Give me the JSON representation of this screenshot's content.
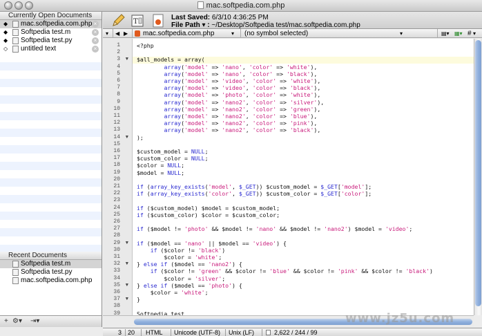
{
  "window": {
    "title": "mac.softpedia.com.php"
  },
  "sidebar": {
    "open_header": "Currently Open Documents",
    "open_docs": [
      {
        "name": "mac.softpedia.com.php",
        "icon": "php-file-icon",
        "selected": true
      },
      {
        "name": "Softpedia test.m",
        "icon": "m-file-icon",
        "selected": false
      },
      {
        "name": "Softpedia test.py",
        "icon": "py-file-icon",
        "selected": false
      },
      {
        "name": "untitled text",
        "icon": "text-file-icon",
        "selected": false
      }
    ],
    "recent_header": "Recent Documents",
    "recent_docs": [
      {
        "name": "Softpedia test.m",
        "selected": true
      },
      {
        "name": "Softpedia test.py",
        "selected": false
      },
      {
        "name": "mac.softpedia.com.php",
        "selected": false
      }
    ]
  },
  "toolbar": {
    "saved_label": "Last Saved:",
    "saved_value": "6/3/10 4:36:25 PM",
    "path_label": "File Path ▾ :",
    "path_value": "~/Desktop/Softpedia test/mac.softpedia.com.php"
  },
  "navbar": {
    "back": "◀",
    "forward": "▶",
    "file_name": "mac.softpedia.com.php",
    "symbol": "(no symbol selected)",
    "hash": "#"
  },
  "code": {
    "lines": [
      [
        [
          "v",
          "<?php"
        ]
      ],
      [
        [
          "v",
          ""
        ]
      ],
      [
        [
          "v",
          "$all_models = array("
        ]
      ],
      [
        [
          "v",
          "        "
        ],
        [
          "k",
          "array"
        ],
        [
          "v",
          "("
        ],
        [
          "s",
          "'model'"
        ],
        [
          "v",
          " => "
        ],
        [
          "s",
          "'nano'"
        ],
        [
          "v",
          ", "
        ],
        [
          "s",
          "'color'"
        ],
        [
          "v",
          " => "
        ],
        [
          "s",
          "'white'"
        ],
        [
          "v",
          "),"
        ]
      ],
      [
        [
          "v",
          "        "
        ],
        [
          "k",
          "array"
        ],
        [
          "v",
          "("
        ],
        [
          "s",
          "'model'"
        ],
        [
          "v",
          " => "
        ],
        [
          "s",
          "'nano'"
        ],
        [
          "v",
          ", "
        ],
        [
          "s",
          "'color'"
        ],
        [
          "v",
          " => "
        ],
        [
          "s",
          "'black'"
        ],
        [
          "v",
          "),"
        ]
      ],
      [
        [
          "v",
          "        "
        ],
        [
          "k",
          "array"
        ],
        [
          "v",
          "("
        ],
        [
          "s",
          "'model'"
        ],
        [
          "v",
          " => "
        ],
        [
          "s",
          "'video'"
        ],
        [
          "v",
          ", "
        ],
        [
          "s",
          "'color'"
        ],
        [
          "v",
          " => "
        ],
        [
          "s",
          "'white'"
        ],
        [
          "v",
          "),"
        ]
      ],
      [
        [
          "v",
          "        "
        ],
        [
          "k",
          "array"
        ],
        [
          "v",
          "("
        ],
        [
          "s",
          "'model'"
        ],
        [
          "v",
          " => "
        ],
        [
          "s",
          "'video'"
        ],
        [
          "v",
          ", "
        ],
        [
          "s",
          "'color'"
        ],
        [
          "v",
          " => "
        ],
        [
          "s",
          "'black'"
        ],
        [
          "v",
          "),"
        ]
      ],
      [
        [
          "v",
          "        "
        ],
        [
          "k",
          "array"
        ],
        [
          "v",
          "("
        ],
        [
          "s",
          "'model'"
        ],
        [
          "v",
          " => "
        ],
        [
          "s",
          "'photo'"
        ],
        [
          "v",
          ", "
        ],
        [
          "s",
          "'color'"
        ],
        [
          "v",
          " => "
        ],
        [
          "s",
          "'white'"
        ],
        [
          "v",
          "),"
        ]
      ],
      [
        [
          "v",
          "        "
        ],
        [
          "k",
          "array"
        ],
        [
          "v",
          "("
        ],
        [
          "s",
          "'model'"
        ],
        [
          "v",
          " => "
        ],
        [
          "s",
          "'nano2'"
        ],
        [
          "v",
          ", "
        ],
        [
          "s",
          "'color'"
        ],
        [
          "v",
          " => "
        ],
        [
          "s",
          "'silver'"
        ],
        [
          "v",
          "),"
        ]
      ],
      [
        [
          "v",
          "        "
        ],
        [
          "k",
          "array"
        ],
        [
          "v",
          "("
        ],
        [
          "s",
          "'model'"
        ],
        [
          "v",
          " => "
        ],
        [
          "s",
          "'nano2'"
        ],
        [
          "v",
          ", "
        ],
        [
          "s",
          "'color'"
        ],
        [
          "v",
          " => "
        ],
        [
          "s",
          "'green'"
        ],
        [
          "v",
          "),"
        ]
      ],
      [
        [
          "v",
          "        "
        ],
        [
          "k",
          "array"
        ],
        [
          "v",
          "("
        ],
        [
          "s",
          "'model'"
        ],
        [
          "v",
          " => "
        ],
        [
          "s",
          "'nano2'"
        ],
        [
          "v",
          ", "
        ],
        [
          "s",
          "'color'"
        ],
        [
          "v",
          " => "
        ],
        [
          "s",
          "'blue'"
        ],
        [
          "v",
          "),"
        ]
      ],
      [
        [
          "v",
          "        "
        ],
        [
          "k",
          "array"
        ],
        [
          "v",
          "("
        ],
        [
          "s",
          "'model'"
        ],
        [
          "v",
          " => "
        ],
        [
          "s",
          "'nano2'"
        ],
        [
          "v",
          ", "
        ],
        [
          "s",
          "'color'"
        ],
        [
          "v",
          " => "
        ],
        [
          "s",
          "'pink'"
        ],
        [
          "v",
          "),"
        ]
      ],
      [
        [
          "v",
          "        "
        ],
        [
          "k",
          "array"
        ],
        [
          "v",
          "("
        ],
        [
          "s",
          "'model'"
        ],
        [
          "v",
          " => "
        ],
        [
          "s",
          "'nano2'"
        ],
        [
          "v",
          ", "
        ],
        [
          "s",
          "'color'"
        ],
        [
          "v",
          " => "
        ],
        [
          "s",
          "'black'"
        ],
        [
          "v",
          "),"
        ]
      ],
      [
        [
          "v",
          ");"
        ]
      ],
      [
        [
          "v",
          ""
        ]
      ],
      [
        [
          "v",
          "$custom_model = "
        ],
        [
          "k",
          "NULL"
        ],
        [
          "v",
          ";"
        ]
      ],
      [
        [
          "v",
          "$custom_color = "
        ],
        [
          "k",
          "NULL"
        ],
        [
          "v",
          ";"
        ]
      ],
      [
        [
          "v",
          "$color = "
        ],
        [
          "k",
          "NULL"
        ],
        [
          "v",
          ";"
        ]
      ],
      [
        [
          "v",
          "$model = "
        ],
        [
          "k",
          "NULL"
        ],
        [
          "v",
          ";"
        ]
      ],
      [
        [
          "v",
          ""
        ]
      ],
      [
        [
          "k",
          "if"
        ],
        [
          "v",
          " ("
        ],
        [
          "k",
          "array_key_exists"
        ],
        [
          "v",
          "("
        ],
        [
          "s",
          "'model'"
        ],
        [
          "v",
          ", "
        ],
        [
          "k",
          "$_GET"
        ],
        [
          "v",
          ")) $custom_model = "
        ],
        [
          "k",
          "$_GET"
        ],
        [
          "v",
          "["
        ],
        [
          "s",
          "'model'"
        ],
        [
          "v",
          "];"
        ]
      ],
      [
        [
          "k",
          "if"
        ],
        [
          "v",
          " ("
        ],
        [
          "k",
          "array_key_exists"
        ],
        [
          "v",
          "("
        ],
        [
          "s",
          "'color'"
        ],
        [
          "v",
          ", "
        ],
        [
          "k",
          "$_GET"
        ],
        [
          "v",
          ")) $custom_color = "
        ],
        [
          "k",
          "$_GET"
        ],
        [
          "v",
          "["
        ],
        [
          "s",
          "'color'"
        ],
        [
          "v",
          "];"
        ]
      ],
      [
        [
          "v",
          ""
        ]
      ],
      [
        [
          "k",
          "if"
        ],
        [
          "v",
          " ($custom_model) $model = $custom_model;"
        ]
      ],
      [
        [
          "k",
          "if"
        ],
        [
          "v",
          " ($custom_color) $color = $custom_color;"
        ]
      ],
      [
        [
          "v",
          ""
        ]
      ],
      [
        [
          "k",
          "if"
        ],
        [
          "v",
          " ($model != "
        ],
        [
          "s",
          "'photo'"
        ],
        [
          "v",
          " && $model != "
        ],
        [
          "s",
          "'nano'"
        ],
        [
          "v",
          " && $model != "
        ],
        [
          "s",
          "'nano2'"
        ],
        [
          "v",
          ") $model = "
        ],
        [
          "s",
          "'video'"
        ],
        [
          "v",
          ";"
        ]
      ],
      [
        [
          "v",
          ""
        ]
      ],
      [
        [
          "k",
          "if"
        ],
        [
          "v",
          " ($model == "
        ],
        [
          "s",
          "'nano'"
        ],
        [
          "v",
          " || $model == "
        ],
        [
          "s",
          "'video'"
        ],
        [
          "v",
          ") {"
        ]
      ],
      [
        [
          "v",
          "    "
        ],
        [
          "k",
          "if"
        ],
        [
          "v",
          " ($color != "
        ],
        [
          "s",
          "'black'"
        ],
        [
          "v",
          ")"
        ]
      ],
      [
        [
          "v",
          "        $color = "
        ],
        [
          "s",
          "'white'"
        ],
        [
          "v",
          ";"
        ]
      ],
      [
        [
          "v",
          "} "
        ],
        [
          "k",
          "else if"
        ],
        [
          "v",
          " ($model == "
        ],
        [
          "s",
          "'nano2'"
        ],
        [
          "v",
          ") {"
        ]
      ],
      [
        [
          "v",
          "    "
        ],
        [
          "k",
          "if"
        ],
        [
          "v",
          " ($color != "
        ],
        [
          "s",
          "'green'"
        ],
        [
          "v",
          " && $color != "
        ],
        [
          "s",
          "'blue'"
        ],
        [
          "v",
          " && $color != "
        ],
        [
          "s",
          "'pink'"
        ],
        [
          "v",
          " && $color != "
        ],
        [
          "s",
          "'black'"
        ],
        [
          "v",
          ")"
        ]
      ],
      [
        [
          "v",
          "        $color = "
        ],
        [
          "s",
          "'silver'"
        ],
        [
          "v",
          ";"
        ]
      ],
      [
        [
          "v",
          "} "
        ],
        [
          "k",
          "else if"
        ],
        [
          "v",
          " ($model == "
        ],
        [
          "s",
          "'photo'"
        ],
        [
          "v",
          ") {"
        ]
      ],
      [
        [
          "v",
          "    $color = "
        ],
        [
          "s",
          "'white'"
        ],
        [
          "v",
          ";"
        ]
      ],
      [
        [
          "v",
          "}"
        ]
      ],
      [
        [
          "v",
          ""
        ]
      ],
      [
        [
          "v",
          "Softpedia test"
        ]
      ]
    ],
    "fold_lines": [
      3,
      14,
      29,
      32,
      35,
      37
    ]
  },
  "statusbar": {
    "line": "3",
    "column": "20",
    "language": "HTML",
    "encoding": "Unicode (UTF-8)",
    "line_endings": "Unix (LF)",
    "counts": "2,622 / 244 / 99"
  },
  "watermark": "www.jz5u.com",
  "colors": {
    "keyword": "#2a2ad0",
    "string": "#c8197a",
    "current_line": "#fdfbdd",
    "scroll_thumb": "#8fb0de"
  }
}
